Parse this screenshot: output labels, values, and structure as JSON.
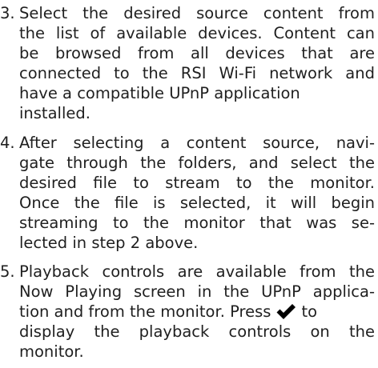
{
  "steps": [
    {
      "number": "3.",
      "lines": [
        "Select the desired source content from",
        "the list of available devices. Content can",
        "be browsed from all devices that are",
        "connected to the RSI Wi-Fi network and",
        "have a compatible UPnP application",
        "installed."
      ]
    },
    {
      "number": "4.",
      "lines": [
        "After selecting a content source, navi-",
        "gate through the folders, and select the",
        "desired file to stream to the monitor.",
        "Once the file is selected, it will begin",
        "streaming to the monitor that was se-",
        "lected in step 2 above."
      ]
    },
    {
      "number": "5.",
      "lines": [
        "Playback controls are available from the",
        "Now Playing screen in the UPnP applica-",
        "tion and from the monitor. Press",
        "display the playback controls on the",
        "monitor."
      ],
      "inline_icon_after": "to",
      "icon": "checkmark-icon"
    }
  ]
}
